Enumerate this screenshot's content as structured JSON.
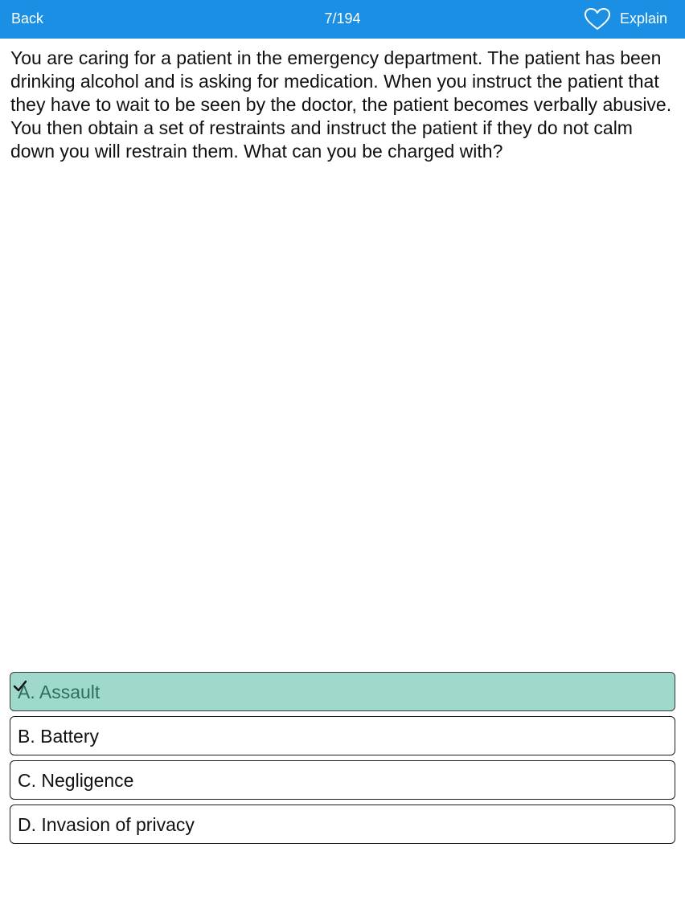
{
  "header": {
    "back_label": "Back",
    "counter": "7/194",
    "favorite_icon": "heart-outline-icon",
    "explain_label": "Explain",
    "background_color": "#1a8fe3"
  },
  "question": {
    "text": "You are caring for a patient in the emergency department. The patient has been drinking alcohol and is asking for medication. When you instruct the patient that they have to wait to be seen by the doctor, the patient becomes verbally abusive. You then obtain a set of restraints and instruct the patient if they do not calm down you will restrain them. What can you be charged with?"
  },
  "answers": [
    {
      "label": "A. Assault",
      "selected": true,
      "icon": "checkmark-icon"
    },
    {
      "label": "B. Battery",
      "selected": false
    },
    {
      "label": "C. Negligence",
      "selected": false
    },
    {
      "label": "D. Invasion of privacy",
      "selected": false
    }
  ],
  "colors": {
    "selected_answer_bg": "#9ed9cb",
    "selected_answer_text": "#2d6e5f"
  }
}
